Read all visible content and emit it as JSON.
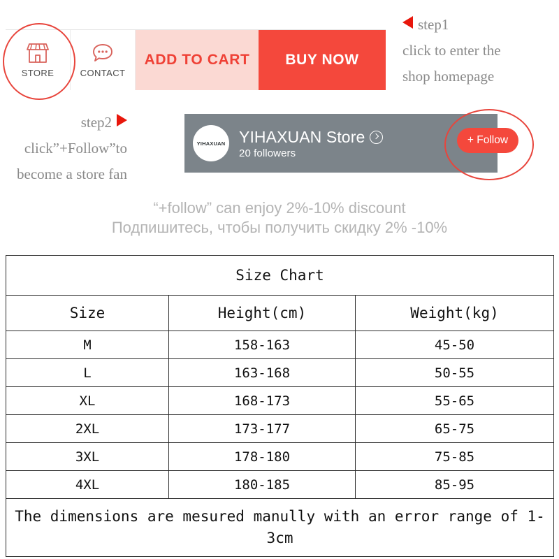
{
  "action_bar": {
    "store_button": {
      "label": "STORE",
      "icon": "storefront-icon"
    },
    "contact_button": {
      "label": "CONTACT",
      "icon": "chat-bubble-icon"
    },
    "add_to_cart_label": "ADD TO CART",
    "buy_now_label": "BUY NOW",
    "colors": {
      "add_to_cart_bg": "#fbd9d3",
      "add_to_cart_text": "#ef4136",
      "buy_now_bg": "#f4483c",
      "buy_now_text": "#ffffff",
      "icon_outline": "#d9635c"
    }
  },
  "annotations": {
    "step1": {
      "arrow": "arrow-left-icon",
      "title": "step1",
      "line1": "click to enter the",
      "line2": "shop homepage"
    },
    "step2": {
      "arrow": "arrow-right-icon",
      "title": "step2",
      "line1": "click”+Follow”to",
      "line2": "become a store fan"
    },
    "circle_color": "#e8453c",
    "arrow_color": "#e8170c"
  },
  "store_banner": {
    "avatar_text": "YIHAXUAN",
    "store_name": "YIHAXUAN Store",
    "chevron_icon": "chevron-right-circle-icon",
    "followers": "20 followers",
    "follow_button_label": "+ Follow",
    "background_color": "#7c848a",
    "follow_button_color": "#f4483c"
  },
  "discount": {
    "line_en": "“+follow”  can enjoy 2%-10% discount",
    "line_ru": "Подпишитесь, чтобы получить скидку 2% -10%",
    "text_color": "#b4b4b4"
  },
  "size_chart": {
    "title": "Size Chart",
    "headers": [
      "Size",
      "Height(cm)",
      "Weight(kg)"
    ],
    "rows": [
      [
        "M",
        "158-163",
        "45-50"
      ],
      [
        "L",
        "163-168",
        "50-55"
      ],
      [
        "XL",
        "168-173",
        "55-65"
      ],
      [
        "2XL",
        "173-177",
        "65-75"
      ],
      [
        "3XL",
        "178-180",
        "75-85"
      ],
      [
        "4XL",
        "180-185",
        "85-95"
      ]
    ],
    "note": "The dimensions are mesured manully with an error range of 1-3cm"
  }
}
